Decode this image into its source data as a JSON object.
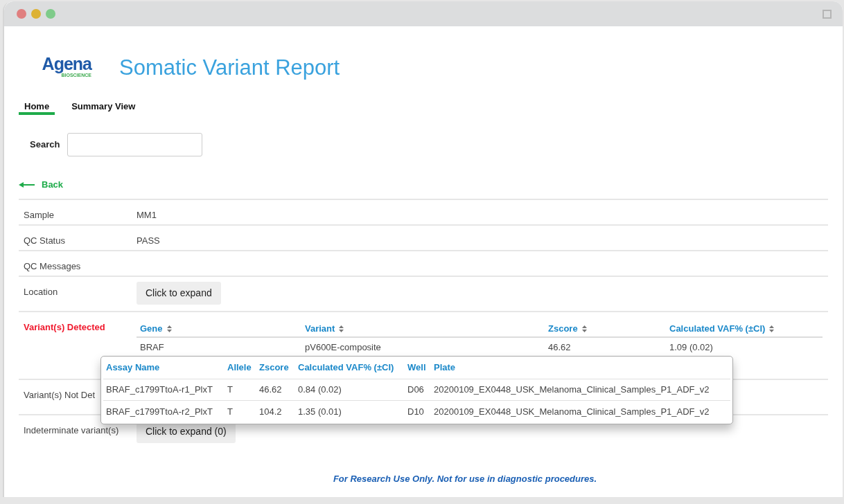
{
  "logo": {
    "name": "Agena",
    "tagline": "BIOSCIENCE"
  },
  "title": "Somatic Variant Report",
  "tabs": [
    {
      "label": "Home",
      "selected": true
    },
    {
      "label": "Summary View",
      "selected": false
    }
  ],
  "search": {
    "label": "Search"
  },
  "back": {
    "label": "Back"
  },
  "details": [
    {
      "kind": "text",
      "label": "Sample",
      "value": "MM1",
      "highlighted": false
    },
    {
      "kind": "text",
      "label": "QC Status",
      "value": "PASS",
      "highlighted": false
    },
    {
      "kind": "text",
      "label": "QC Messages",
      "highlighted": false
    },
    {
      "kind": "button",
      "label": "Location",
      "button": "Click to expand",
      "highlighted": false
    },
    {
      "kind": "table",
      "label": "Variant(s) Detected",
      "highlighted": true,
      "columns": [
        "Gene",
        "Variant",
        "Zscore",
        "Calculated VAF% (±CI)"
      ],
      "rows": [
        [
          "BRAF",
          "pV600E-composite",
          "46.62",
          "1.09 (0.02)"
        ]
      ]
    },
    {
      "kind": "text",
      "label": "Variant(s) Not Det",
      "highlighted": false
    },
    {
      "kind": "button",
      "label": "Indeterminate variant(s)",
      "button": "Click to expand (0)",
      "highlighted": false
    }
  ],
  "popup": {
    "columns": [
      "Assay Name",
      "Allele",
      "Zscore",
      "Calculated VAF% (±CI)",
      "Well",
      "Plate"
    ],
    "rows": [
      [
        "BRAF_c1799TtoA-r1_PlxT",
        "T",
        "46.62",
        "0.84 (0.02)",
        "D06",
        "20200109_EX0448_USK_Melanoma_Clinical_Samples_P1_ADF_v2"
      ],
      [
        "BRAF_c1799TtoA-r2_PlxT",
        "T",
        "104.2",
        "1.35 (0.01)",
        "D10",
        "20200109_EX0448_USK_Melanoma_Clinical_Samples_P1_ADF_v2"
      ]
    ]
  },
  "footer": "For Research Use Only. Not for use in diagnostic procedures."
}
